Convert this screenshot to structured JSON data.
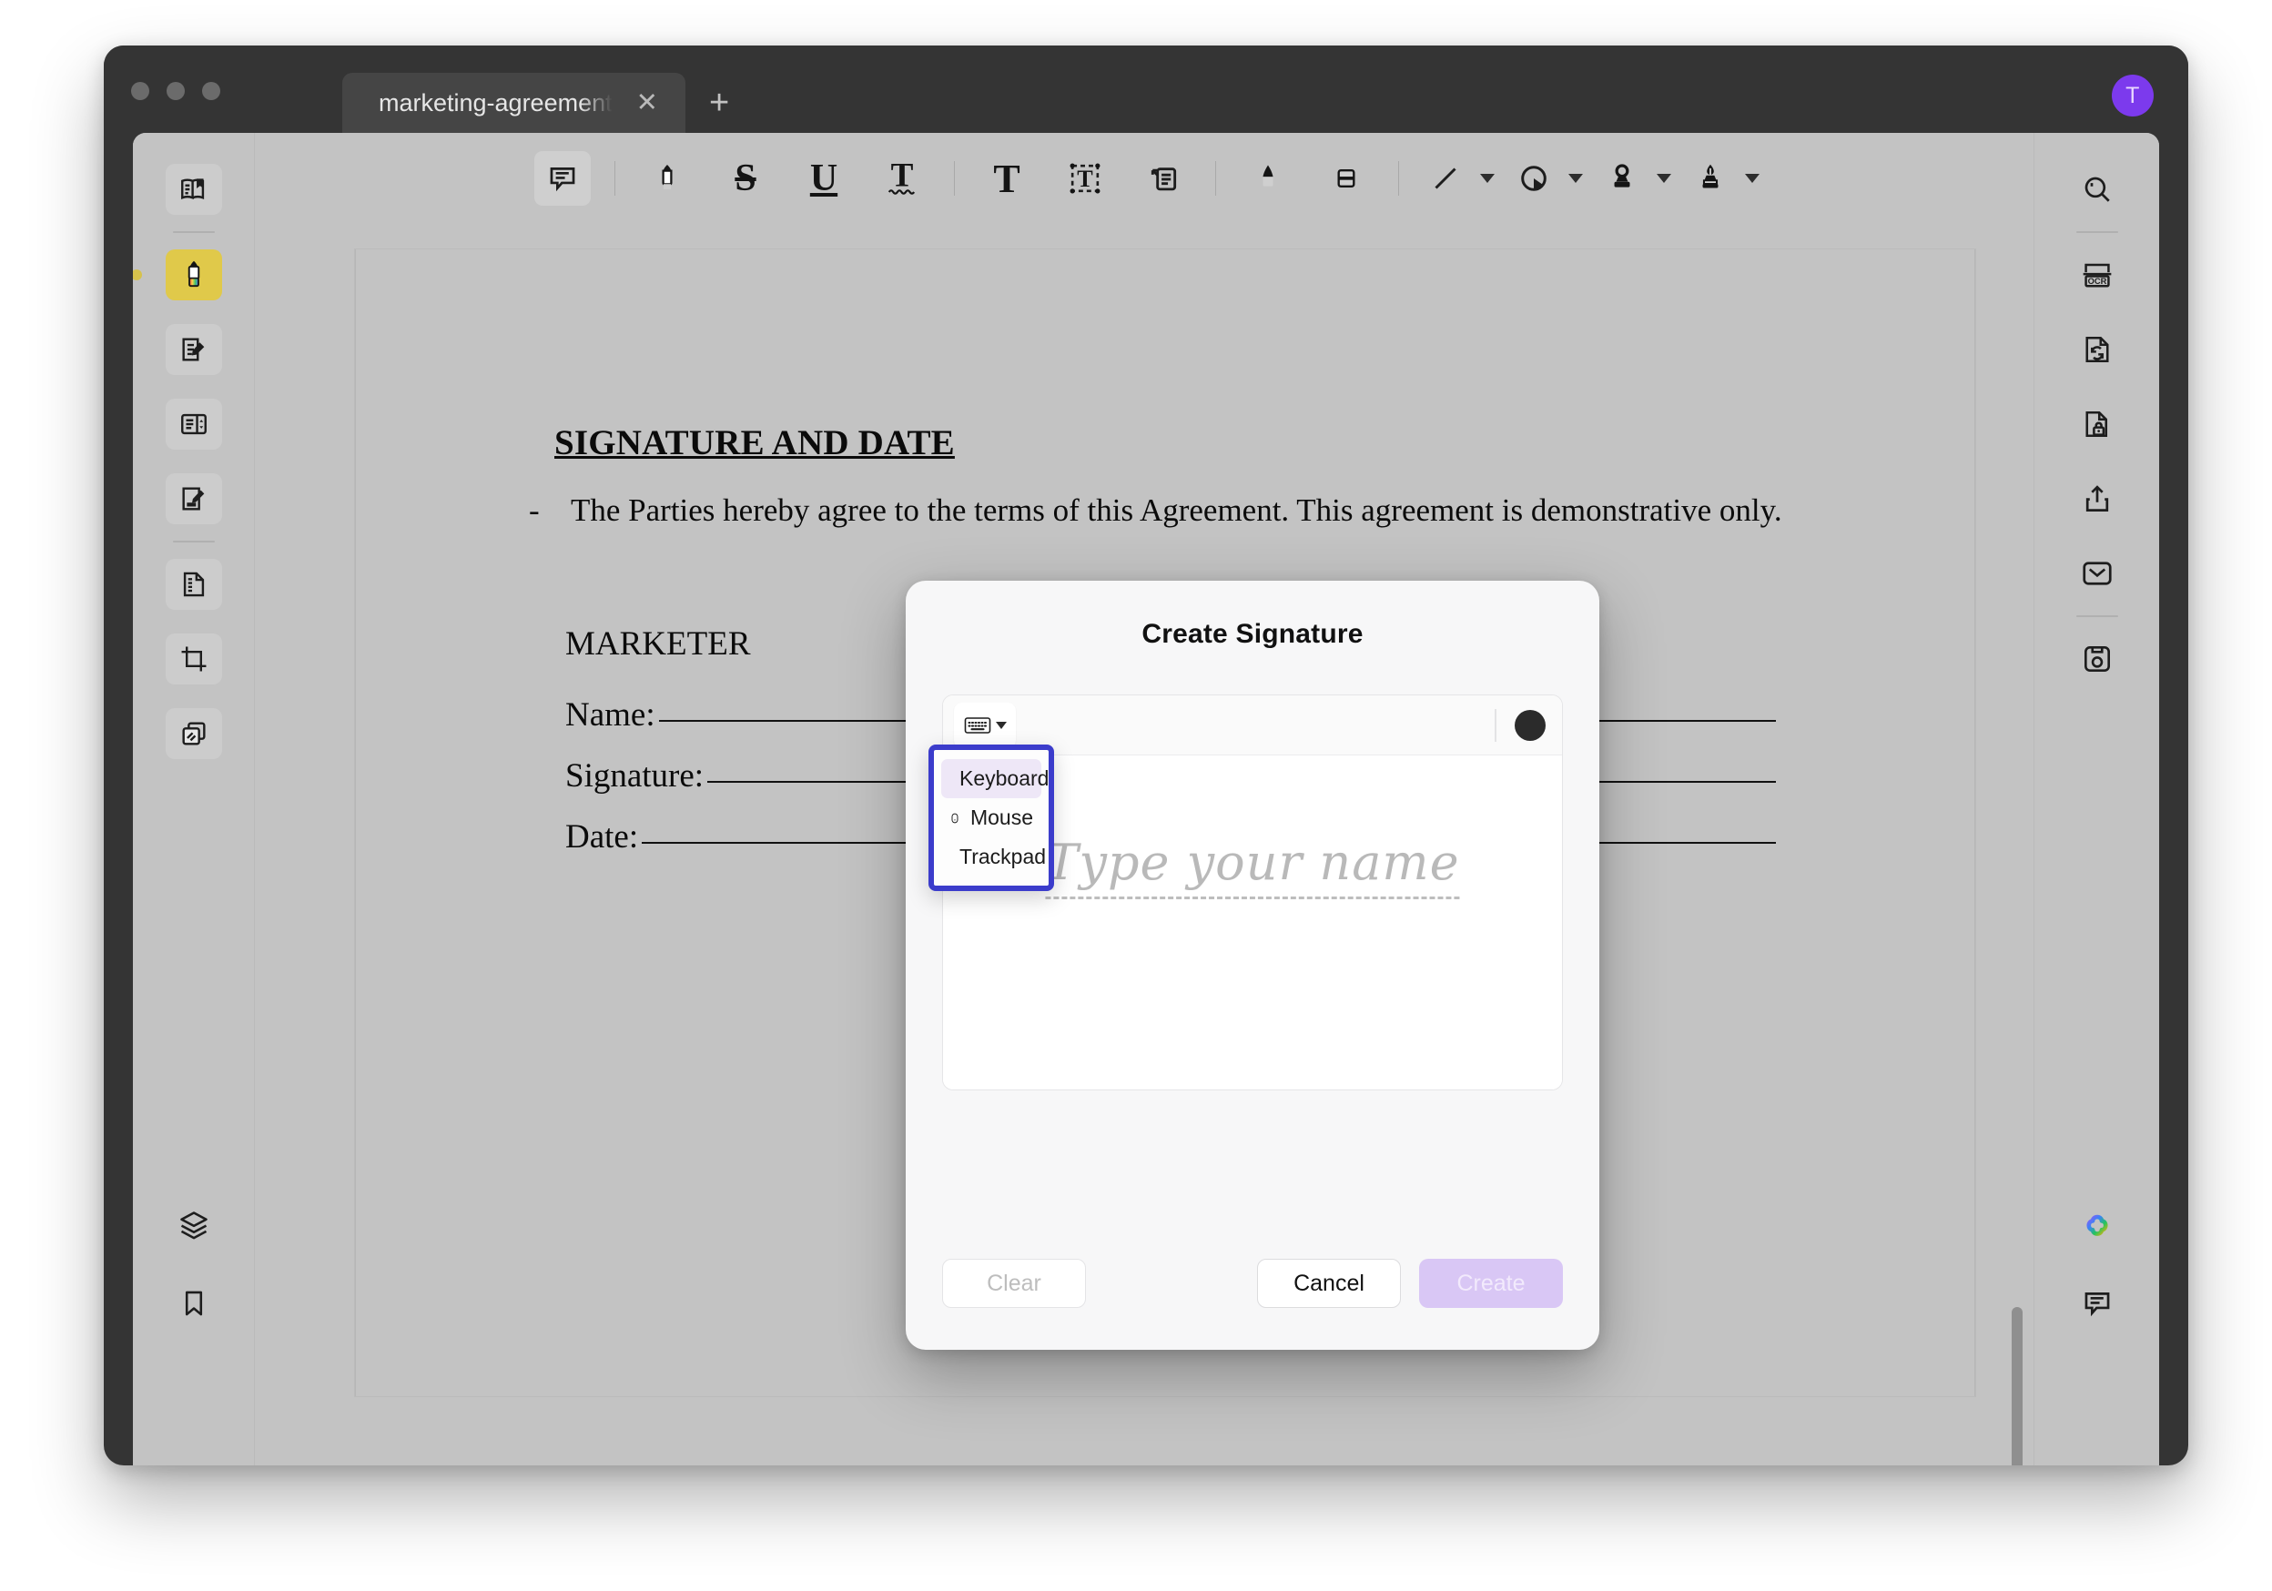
{
  "window": {
    "traffic_lights": [
      "close",
      "minimize",
      "maximize"
    ],
    "tab": {
      "label": "marketing-agreement",
      "close": "✕"
    },
    "new_tab": "+",
    "avatar_initial": "T"
  },
  "toolbar": {
    "items": [
      {
        "name": "comment-icon",
        "label": "Comment"
      },
      {
        "name": "highlighter-icon",
        "label": "Highlight"
      },
      {
        "name": "strikethrough-icon",
        "label": "Strikethrough"
      },
      {
        "name": "underline-icon",
        "label": "Underline"
      },
      {
        "name": "squiggly-underline-icon",
        "label": "Squiggly"
      },
      {
        "name": "text-icon",
        "label": "Text"
      },
      {
        "name": "text-box-icon",
        "label": "Text Box"
      },
      {
        "name": "callout-icon",
        "label": "Callout"
      },
      {
        "name": "pen-icon",
        "label": "Pen"
      },
      {
        "name": "eraser-icon",
        "label": "Eraser"
      },
      {
        "name": "line-icon",
        "label": "Line"
      },
      {
        "name": "shape-icon",
        "label": "Shape"
      },
      {
        "name": "stamp-icon",
        "label": "Stamp"
      },
      {
        "name": "signature-icon",
        "label": "Signature"
      }
    ]
  },
  "left_rail": {
    "items": [
      {
        "name": "sidebar-item-outline",
        "label": "Outline"
      },
      {
        "name": "sidebar-item-highlighter",
        "label": "Highlighter",
        "active": true
      },
      {
        "name": "sidebar-item-annotate",
        "label": "Annotate"
      },
      {
        "name": "sidebar-item-thumbnails",
        "label": "Page Thumbnails"
      },
      {
        "name": "sidebar-item-edit-page",
        "label": "Edit Page"
      },
      {
        "name": "sidebar-item-organize",
        "label": "Organize Pages"
      },
      {
        "name": "sidebar-item-crop",
        "label": "Crop"
      },
      {
        "name": "sidebar-item-duplicate",
        "label": "Duplicate"
      },
      {
        "name": "sidebar-item-layers",
        "label": "Layers"
      },
      {
        "name": "sidebar-item-bookmark",
        "label": "Bookmark"
      }
    ]
  },
  "right_rail": {
    "items": [
      {
        "name": "search-icon",
        "label": "Search"
      },
      {
        "name": "ocr-icon",
        "label": "OCR"
      },
      {
        "name": "convert-icon",
        "label": "Convert"
      },
      {
        "name": "protect-icon",
        "label": "Protect"
      },
      {
        "name": "share-icon",
        "label": "Share"
      },
      {
        "name": "email-icon",
        "label": "Email"
      },
      {
        "name": "save-icon",
        "label": "Save"
      },
      {
        "name": "ai-icon",
        "label": "AI Assistant"
      },
      {
        "name": "comments-panel-icon",
        "label": "Comments"
      }
    ]
  },
  "document": {
    "heading": "SIGNATURE AND DATE",
    "bullet_dash": "-",
    "bullet_text": "The Parties hereby agree to the terms of this Agreement. This agreement is demonstrative only.",
    "party_label": "MARKETER",
    "fields": [
      {
        "name": "field-name",
        "label": "Name:"
      },
      {
        "name": "field-signature",
        "label": "Signature:"
      },
      {
        "name": "field-date",
        "label": "Date:"
      }
    ]
  },
  "dialog": {
    "title": "Create Signature",
    "mode_button_icon": "keyboard-icon",
    "color_swatch": "#2b2b2b",
    "canvas_placeholder": "Type your name",
    "menu": {
      "highlight_color": "#3b3ccb",
      "items": [
        {
          "name": "menu-item-keyboard",
          "label": "Keyboard",
          "icon": "keyboard-icon",
          "selected": true
        },
        {
          "name": "menu-item-mouse",
          "label": "Mouse",
          "icon": "mouse-icon",
          "selected": false
        },
        {
          "name": "menu-item-trackpad",
          "label": "Trackpad",
          "icon": "trackpad-icon",
          "selected": false
        }
      ]
    },
    "buttons": {
      "clear": "Clear",
      "cancel": "Cancel",
      "create": "Create"
    }
  }
}
